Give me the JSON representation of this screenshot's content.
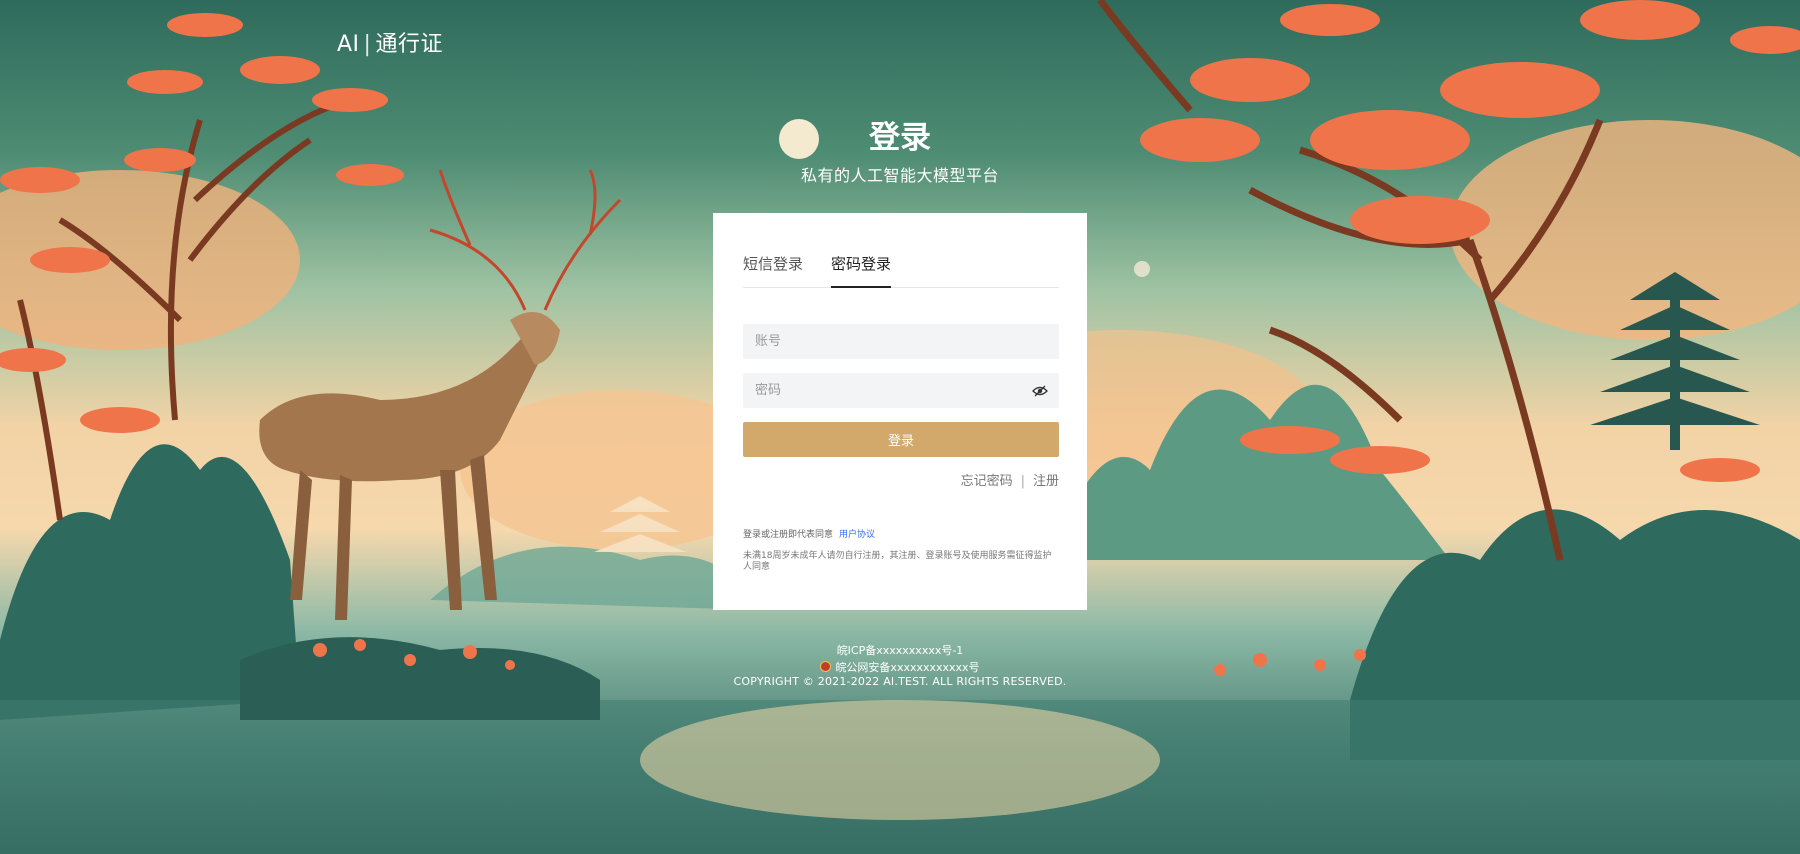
{
  "header": {
    "logo_left": "AI",
    "logo_separator": "|",
    "logo_right": "通行证"
  },
  "hero": {
    "title": "登录",
    "subtitle": "私有的人工智能大模型平台"
  },
  "login": {
    "tabs": [
      {
        "label": "短信登录",
        "active": false
      },
      {
        "label": "密码登录",
        "active": true
      }
    ],
    "account_placeholder": "账号",
    "account_value": "",
    "password_placeholder": "密码",
    "password_value": "",
    "submit_label": "登录",
    "forgot_label": "忘记密码",
    "divider": "|",
    "register_label": "注册",
    "agreement_text": "登录或注册即代表同意",
    "agreement_link": "用户协议",
    "minor_notice": "未满18周岁未成年人请勿自行注册，其注册、登录账号及使用服务需征得监护人同意"
  },
  "footer": {
    "icp": "皖ICP备xxxxxxxxxx号-1",
    "police": "皖公网安备xxxxxxxxxxxx号",
    "copyright": "COPYRIGHT © 2021-2022 AI.TEST. ALL RIGHTS RESERVED."
  },
  "colors": {
    "button": "#d2a96b",
    "link": "#3b6cf2",
    "accent_orange": "#f0744a"
  },
  "icons": {
    "password_visibility": "eye-slash-icon",
    "police_badge": "police-badge-icon"
  }
}
